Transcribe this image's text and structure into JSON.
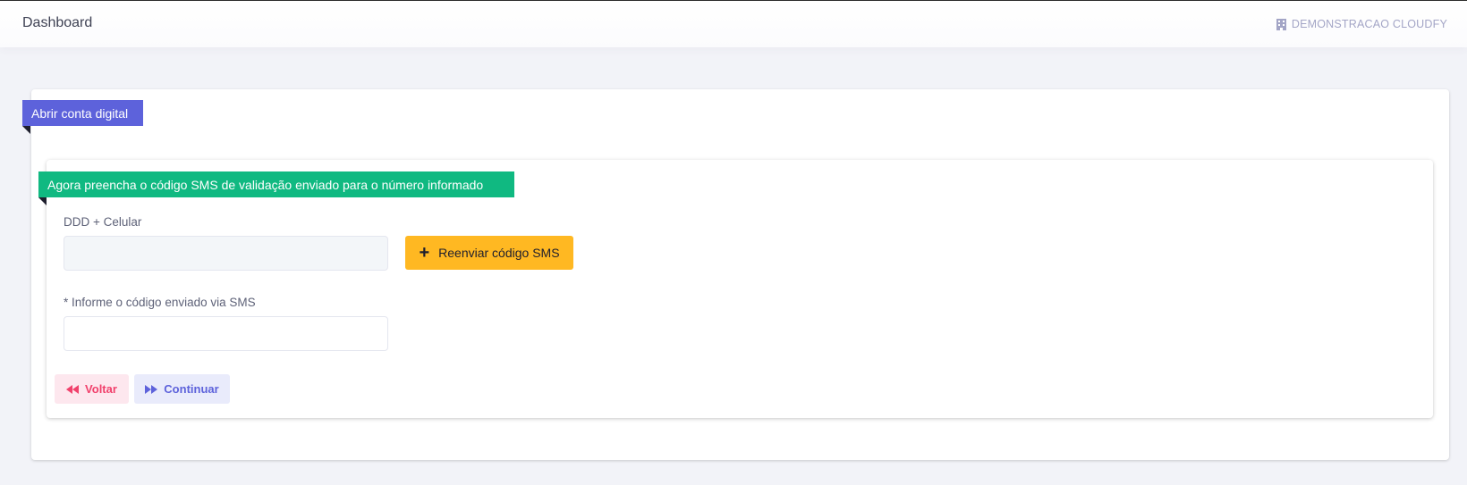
{
  "header": {
    "title": "Dashboard",
    "organization": "DEMONSTRACAO CLOUDFY",
    "organization_icon": "building-icon"
  },
  "card": {
    "ribbon": "Abrir conta digital"
  },
  "form": {
    "ribbon": "Agora preencha o código SMS de validação enviado para o número informado",
    "phone_label": "DDD + Celular",
    "phone_value": "",
    "resend_button": "Reenviar código SMS",
    "resend_icon": "plus-icon",
    "code_label": "* Informe o código enviado via SMS",
    "code_value": "",
    "back_button": "Voltar",
    "back_icon": "rewind-icon",
    "continue_button": "Continuar",
    "continue_icon": "fast-forward-icon"
  },
  "colors": {
    "primary": "#5d62db",
    "success": "#10b981",
    "warning": "#ffb822",
    "danger": "#f1416c"
  }
}
